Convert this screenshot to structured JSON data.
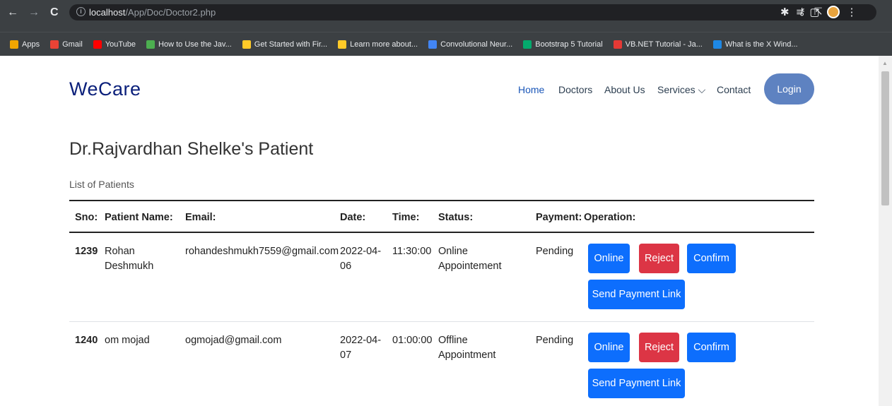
{
  "browser": {
    "url_prefix": "localhost",
    "url_path": "/App/Doc/Doctor2.php",
    "nav": {
      "back": "←",
      "forward": "→",
      "reload": "C"
    },
    "bookmarks": [
      {
        "label": "Apps",
        "icon": "apps-grid-icon",
        "color": "#f2a600"
      },
      {
        "label": "Gmail",
        "icon": "gmail-icon",
        "color": "#ea4335"
      },
      {
        "label": "YouTube",
        "icon": "youtube-icon",
        "color": "#ff0000"
      },
      {
        "label": "How to Use the Jav...",
        "icon": "javatpoint-icon",
        "color": "#4caf50"
      },
      {
        "label": "Get Started with Fir...",
        "icon": "firebase-icon",
        "color": "#ffca28"
      },
      {
        "label": "Learn more about...",
        "icon": "firebase-icon",
        "color": "#ffca28"
      },
      {
        "label": "Convolutional Neur...",
        "icon": "globe-icon",
        "color": "#4285f4"
      },
      {
        "label": "Bootstrap 5 Tutorial",
        "icon": "w3schools-icon",
        "color": "#04aa6d"
      },
      {
        "label": "VB.NET Tutorial - Ja...",
        "icon": "javatpoint-icon",
        "color": "#e53935"
      },
      {
        "label": "What is the X Wind...",
        "icon": "info-icon",
        "color": "#1e88e5"
      }
    ]
  },
  "site": {
    "brand": "WeCare",
    "nav_items": [
      "Home",
      "Doctors",
      "About Us",
      "Services ⌵",
      "Contact"
    ],
    "login_label": "Login"
  },
  "main": {
    "title": "Dr.Rajvardhan Shelke's Patient",
    "subtitle": "List of Patients",
    "columns": [
      "Sno:",
      "Patient Name:",
      "Email:",
      "Date:",
      "Time:",
      "Status:",
      "Payment:",
      "Operation:"
    ],
    "rows": [
      {
        "sno": "1239",
        "name": "Rohan Deshmukh",
        "email": "rohandeshmukh7559@gmail.com",
        "date": "2022-04-06",
        "time": "11:30:00",
        "status": "Online Appointement",
        "payment": "Pending"
      },
      {
        "sno": "1240",
        "name": "om mojad",
        "email": "ogmojad@gmail.com",
        "date": "2022-04-07",
        "time": "01:00:00",
        "status": "Offline Appointment",
        "payment": "Pending"
      }
    ],
    "buttons": {
      "online": "Online",
      "reject": "Reject",
      "confirm": "Confirm",
      "payment_link": "Send Payment Link"
    },
    "colors": {
      "primary": "#0d6efd",
      "danger": "#dc3545",
      "login": "#5e82c1",
      "brand": "#0a1f7a"
    }
  }
}
